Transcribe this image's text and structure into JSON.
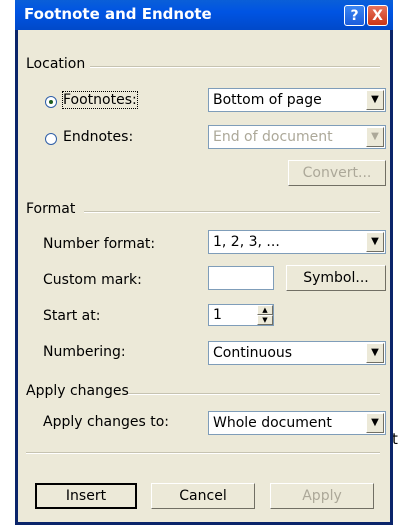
{
  "stray_text": "t",
  "window": {
    "title": "Footnote and Endnote",
    "help_icon": "?",
    "close_icon": "X"
  },
  "location": {
    "group_label": "Location",
    "footnotes": {
      "label": "Footnotes:",
      "selected": true,
      "value": "Bottom of page"
    },
    "endnotes": {
      "label": "Endnotes:",
      "selected": false,
      "value": "End of document"
    },
    "convert_label": "Convert..."
  },
  "format": {
    "group_label": "Format",
    "number_format": {
      "label": "Number format:",
      "value": "1, 2, 3, ..."
    },
    "custom_mark": {
      "label": "Custom mark:",
      "value": "",
      "symbol_label": "Symbol..."
    },
    "start_at": {
      "label": "Start at:",
      "value": "1"
    },
    "numbering": {
      "label": "Numbering:",
      "value": "Continuous"
    }
  },
  "apply_changes": {
    "group_label": "Apply changes",
    "apply_to": {
      "label": "Apply changes to:",
      "value": "Whole document"
    }
  },
  "buttons": {
    "insert": "Insert",
    "cancel": "Cancel",
    "apply": "Apply"
  }
}
